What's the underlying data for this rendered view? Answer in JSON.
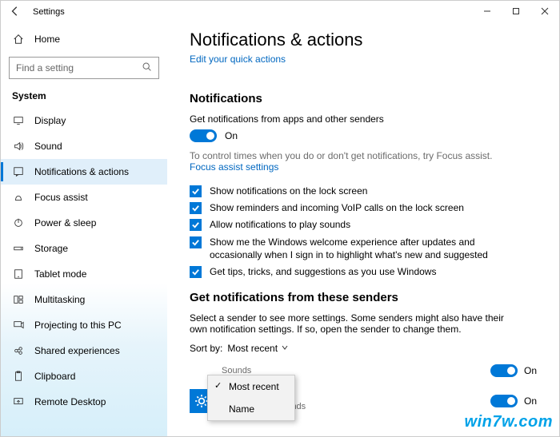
{
  "titlebar": {
    "title": "Settings"
  },
  "sidebar": {
    "home": "Home",
    "search_placeholder": "Find a setting",
    "group": "System",
    "items": [
      {
        "label": "Display"
      },
      {
        "label": "Sound"
      },
      {
        "label": "Notifications & actions"
      },
      {
        "label": "Focus assist"
      },
      {
        "label": "Power & sleep"
      },
      {
        "label": "Storage"
      },
      {
        "label": "Tablet mode"
      },
      {
        "label": "Multitasking"
      },
      {
        "label": "Projecting to this PC"
      },
      {
        "label": "Shared experiences"
      },
      {
        "label": "Clipboard"
      },
      {
        "label": "Remote Desktop"
      }
    ]
  },
  "main": {
    "title": "Notifications & actions",
    "quick_link": "Edit your quick actions",
    "section1": {
      "heading": "Notifications",
      "desc": "Get notifications from apps and other senders",
      "toggle_state": "On",
      "focus_hint": "To control times when you do or don't get notifications, try Focus assist.",
      "focus_link": "Focus assist settings",
      "checks": [
        "Show notifications on the lock screen",
        "Show reminders and incoming VoIP calls on the lock screen",
        "Allow notifications to play sounds",
        "Show me the Windows welcome experience after updates and occasionally when I sign in to highlight what's new and suggested",
        "Get tips, tricks, and suggestions as you use Windows"
      ]
    },
    "section2": {
      "heading": "Get notifications from these senders",
      "desc": "Select a sender to see more settings. Some senders might also have their own notification settings. If so, open the sender to change them.",
      "sort_label": "Sort by:",
      "sort_value": "Most recent",
      "dropdown": [
        "Most recent",
        "Name"
      ],
      "senders": [
        {
          "name": "",
          "sub": "Sounds",
          "state": "On"
        },
        {
          "name": "Settings",
          "sub": "On: Banners, Sounds",
          "state": "On"
        }
      ]
    }
  },
  "watermark": "win7w.com"
}
